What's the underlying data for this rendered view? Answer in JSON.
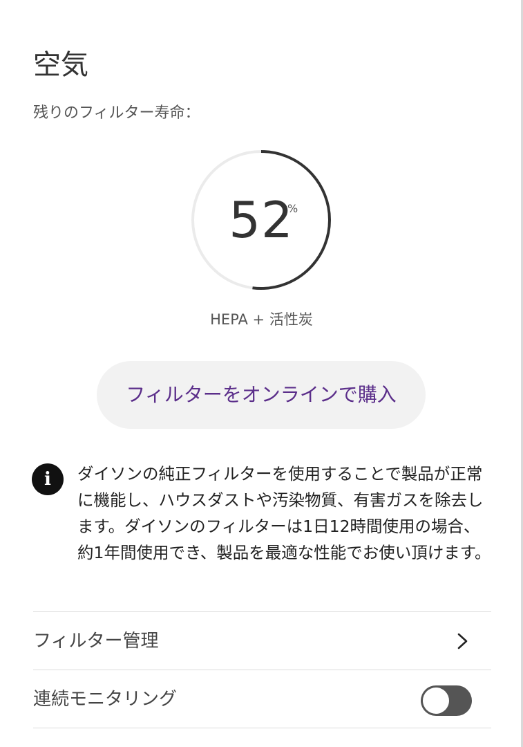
{
  "page": {
    "title": "空気",
    "subtitle": "残りのフィルター寿命："
  },
  "filter": {
    "remaining_percent": 52,
    "remaining_display": "52",
    "unit": "%",
    "type": "HEPA + 活性炭",
    "buy_button_label": "フィルターをオンラインで購入"
  },
  "info": {
    "icon": "info-icon",
    "icon_glyph": "i",
    "text": "ダイソンの純正フィルターを使用することで製品が正常に機能し、ハウスダストや汚染物質、有害ガスを除去します。ダイソンのフィルターは1日12時間使用の場合、約1年間使用でき、製品を最適な性能でお使い頂けます。"
  },
  "settings": [
    {
      "label": "フィルター管理",
      "control": "chevron-right-icon"
    },
    {
      "label": "連続モニタリング",
      "control": "toggle",
      "enabled": false
    }
  ],
  "colors": {
    "accent_text": "#5b2e8a",
    "gauge_progress": "#333333",
    "gauge_track": "#ebebeb",
    "button_background": "#f2f2f2",
    "toggle_background": "#555555"
  }
}
